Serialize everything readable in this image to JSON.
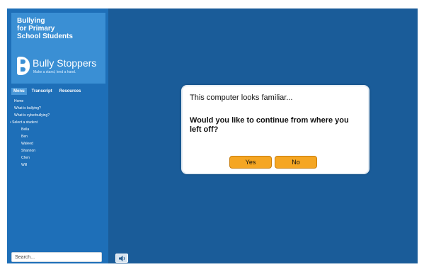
{
  "brand": {
    "title_lines": [
      "Bullying",
      "for Primary",
      "School Students"
    ],
    "logo_name": "Bully Stoppers",
    "logo_tagline": "Make a stand, lend a hand."
  },
  "tabs": [
    {
      "label": "Menu",
      "active": true
    },
    {
      "label": "Transcript",
      "active": false
    },
    {
      "label": "Resources",
      "active": false
    }
  ],
  "menu": {
    "items": [
      {
        "label": "Home"
      },
      {
        "label": "What is bullying?"
      },
      {
        "label": "What is cyberbullying?"
      },
      {
        "label": "Select a student"
      }
    ],
    "students": [
      {
        "label": "Bella"
      },
      {
        "label": "Ben"
      },
      {
        "label": "Waleed"
      },
      {
        "label": "Shannon"
      },
      {
        "label": "Chen"
      },
      {
        "label": "Will"
      }
    ]
  },
  "search": {
    "placeholder": "Search..."
  },
  "dialog": {
    "title": "This computer looks familiar...",
    "question": "Would you like to continue from where you left off?",
    "yes_label": "Yes",
    "no_label": "No"
  },
  "colors": {
    "stage_bg": "#1a5c99",
    "sidebar_bg": "#1e6fb8",
    "brand_bg": "#3a8fd4",
    "button_bg": "#f5a623"
  },
  "icons": {
    "sound": "speaker-icon"
  }
}
